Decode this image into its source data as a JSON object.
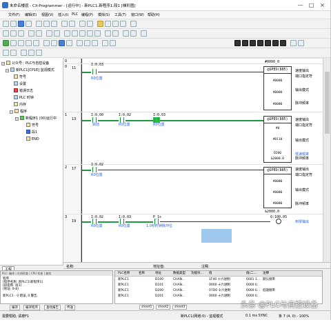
{
  "window": {
    "title": "未命名楼层 - CX-Programmer - [运行中] - 新PLC1.新程序1.段1 [梯形图]",
    "controls": [
      "—",
      "□",
      "×"
    ]
  },
  "menu": [
    "文件(F)",
    "编辑(E)",
    "视图(V)",
    "插入(I)",
    "PLC",
    "编程(P)",
    "模拟(S)",
    "工具(T)",
    "窗口(W)",
    "帮助(H)"
  ],
  "tree": {
    "items": [
      {
        "label": "公众号：PLC与自控设备",
        "icon": "project-icon",
        "indent": 0
      },
      {
        "label": "新PLC1[CP1E] 监视模式",
        "icon": "plc-icon",
        "indent": 1
      },
      {
        "label": "符号",
        "icon": "symbols-icon",
        "indent": 2
      },
      {
        "label": "设置",
        "icon": "settings-icon",
        "indent": 2
      },
      {
        "label": "错误日志",
        "icon": "error-log-icon",
        "indent": 2
      },
      {
        "label": "PLC 时钟",
        "icon": "clock-icon",
        "indent": 2
      },
      {
        "label": "内存",
        "icon": "memory-icon",
        "indent": 2
      },
      {
        "label": "程序",
        "icon": "programs-icon",
        "indent": 2
      },
      {
        "label": "新程序1 (00)运行中",
        "icon": "program-icon",
        "indent": 3
      },
      {
        "label": "符号",
        "icon": "local-symbols-icon",
        "indent": 4
      },
      {
        "label": "段1",
        "icon": "section-icon",
        "indent": 4
      },
      {
        "label": "END",
        "icon": "end-section-icon",
        "indent": 4
      }
    ],
    "tab_label": "工程"
  },
  "ladder": {
    "rungs": [
      {
        "step": "11",
        "row": "0"
      },
      {
        "step": "13",
        "row": "1"
      },
      {
        "step": "17",
        "row": "2"
      },
      {
        "step": "19",
        "row": "3"
      }
    ],
    "top_rung_partial": "0",
    "contacts": {
      "r0c0_addr": "I:0.03",
      "r0c0_label": "R0位置",
      "r1c0_addr": "I:0.00",
      "r1c0_label": "启动",
      "r1c1_addr": "I:0.02",
      "r1c1_label": "R0位置",
      "r1c2_addr": "I:0.03",
      "r1c2_label": "R0位置",
      "r2c0_addr": "I:0.02",
      "r2c0_label": "R0位置",
      "r3c0_addr": "I:0.02",
      "r3c0_label": "R0位置",
      "r3c1_addr": "I:0.03",
      "r3c1_label": "R0位置",
      "r3c2_addr": "P_1s",
      "r3c2_label": "1.0秒时钟脉冲位"
    },
    "blocks": {
      "b0_head": "@SPED(885)",
      "b0_ops": [
        "#0000",
        "#0000",
        "#0000"
      ],
      "b0_comments": [
        "速度输出",
        "端口指定符",
        "输出模式",
        "脉冲频率"
      ],
      "b0_top": "#0000_0",
      "b1_head": "@SPED(885)",
      "b1_ops": [
        "#0",
        "#0110",
        "D200"
      ],
      "b1_comments": [
        "速度输出",
        "端口指定符",
        "输出模式",
        "低速频率",
        "脉冲频率"
      ],
      "b1_extra": "&2000.0",
      "b2_head": "@SPED(885)",
      "b2_ops": [
        "#0000",
        "#0000",
        "#0000"
      ],
      "b2_comments": [
        "速度输出",
        "端口指定符",
        "输出模式",
        "脉冲频率"
      ],
      "b2_bottom": "&2000.0",
      "coil_addr": "Q:100.05",
      "coil_label": "到零输出"
    }
  },
  "infobar": {
    "name_label": "名称:",
    "addr_label": "地址值:",
    "comment_label": "注释:"
  },
  "output": {
    "title": "PLC: 编译 | 在线检查 | CPU 检查 | 查找",
    "lines": [
      "程序",
      "[程序名称: 新PLC1\\新程序1]",
      "[段名称: 段1]",
      "[地址: 0-8]",
      "新PLC1 - 0 错误, 0 警告."
    ],
    "tabs": [
      "编译",
      "编译程序",
      "查找报告",
      "传送"
    ]
  },
  "watch": {
    "headers": [
      "PLC名称",
      "名称",
      "地址",
      "数据类型",
      "功能块...",
      "值",
      "值(二...",
      "注释"
    ],
    "rows": [
      [
        "新PLC1",
        "",
        "D100",
        "CHAN...",
        "",
        "1F40 十六进制",
        "0001 1...",
        "默认频率"
      ],
      [
        "新PLC1",
        "",
        "D101",
        "CHAN...",
        "",
        "0000 十六进制",
        "0000 0...",
        ""
      ],
      [
        "新PLC1",
        "",
        "D200",
        "CHAN...",
        "",
        "07D0 十六进制",
        "0000 0...",
        "低速频率"
      ],
      [
        "新PLC1",
        "",
        "D201",
        "CHAN...",
        "",
        "0000 十六进制",
        "0000 0...",
        ""
      ]
    ],
    "tabs": [
      "sheet1",
      "sheet2",
      "sheet3"
    ]
  },
  "status": {
    "help": "需要帮助, 请按F1",
    "mode": "新PLC1(网络:0) - 监视模式",
    "cycle": "0.1 ms SYNC",
    "pos": "条 7 (4, 0) - 100%"
  },
  "watermark": "头条 @PLC与自控设备"
}
